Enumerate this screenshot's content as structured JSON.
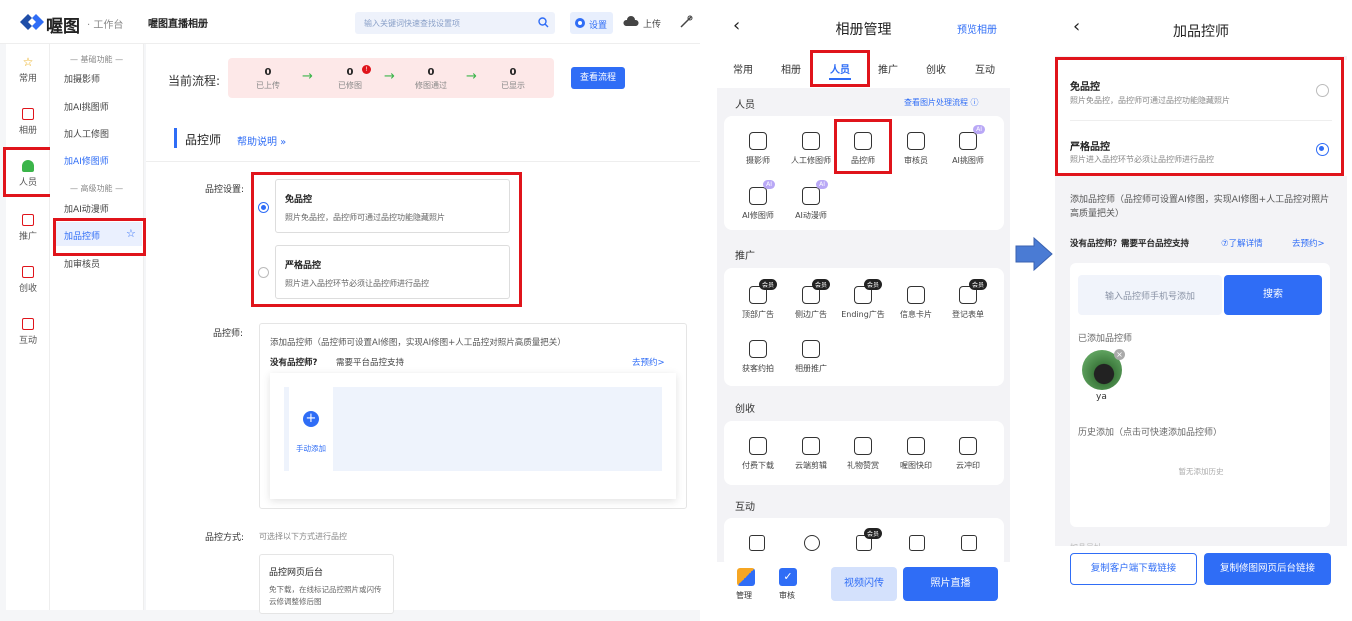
{
  "desktop": {
    "logo": "喔图",
    "workspace": "· 工作台",
    "album_title": "喔图直播相册",
    "search_placeholder": "输入关键词快速查找设置项",
    "settings": "设置",
    "upload": "上传",
    "leftnav": [
      "常用",
      "相册",
      "人员",
      "推广",
      "创收",
      "互动"
    ],
    "submenu": {
      "group1": "— 基础功能 —",
      "items1": [
        "加摄影师",
        "加AI挑图师",
        "加人工修图",
        "加AI修图师"
      ],
      "group2": "— 高级功能 —",
      "items2": [
        "加AI动漫师",
        "加品控师",
        "加审核员"
      ]
    },
    "flow_label": "当前流程:",
    "flow": [
      {
        "value": "0",
        "label": "已上传"
      },
      {
        "value": "0",
        "label": "已修图"
      },
      {
        "value": "0",
        "label": "修图通过"
      },
      {
        "value": "0",
        "label": "已显示"
      }
    ],
    "view_flow_btn": "查看流程",
    "section_title": "品控师",
    "help": "帮助说明 »",
    "qc_setting_label": "品控设置:",
    "opt1_title": "免品控",
    "opt1_desc": "照片免品控，品控师可通过品控功能隐藏照片",
    "opt2_title": "严格品控",
    "opt2_desc": "照片进入品控环节必须让品控师进行品控",
    "qc_person_label": "品控师:",
    "add_desc": "添加品控师（品控师可设置AI修图，实现AI修图+人工品控对照片高质量把关）",
    "no_qc": "没有品控师?",
    "need_support": "需要平台品控支持",
    "reserve": "去预约>",
    "manual_add": "手动添加",
    "qc_method_label": "品控方式:",
    "qc_method_hint": "可选择以下方式进行品控",
    "web_backend": "品控网页后台",
    "web_backend_desc1": "免下载，在线标记品控照片或闪传",
    "web_backend_desc2": "云修调整修后图"
  },
  "phone1": {
    "title": "相册管理",
    "preview": "预览相册",
    "tabs": [
      "常用",
      "相册",
      "人员",
      "推广",
      "创收",
      "互动"
    ],
    "staff_title": "人员",
    "staff_link": "查看图片处理流程 ⓘ",
    "staff": [
      "摄影师",
      "人工修图师",
      "品控师",
      "审核员",
      "AI挑图师",
      "AI修图师",
      "AI动漫师"
    ],
    "ai_badge": "AI",
    "promo_title": "推广",
    "promo": [
      "顶部广告",
      "侧边广告",
      "Ending广告",
      "信息卡片",
      "登记表单",
      "获客约拍",
      "相册推广"
    ],
    "member_badge": "会员",
    "income_title": "创收",
    "income": [
      "付费下载",
      "云端剪辑",
      "礼物赞赏",
      "喔图快印",
      "云冲印"
    ],
    "interact_title": "互动",
    "bottom_manage": "管理",
    "bottom_review": "审核",
    "video_flash": "视频闪传",
    "photo_live": "照片直播"
  },
  "phone2": {
    "title": "加品控师",
    "opt1_title": "免品控",
    "opt1_desc": "照片免品控，品控师可通过品控功能隐藏照片",
    "opt2_title": "严格品控",
    "opt2_desc": "照片进入品控环节必须让品控师进行品控",
    "add_desc": "添加品控师（品控师可设置AI修图，实现AI修图+人工品控对照片高质量把关）",
    "no_qc": "没有品控师？需要平台品控支持",
    "learn_more": "⑦了解详情",
    "reserve": "去预约>",
    "phone_placeholder": "输入品控师手机号添加",
    "search_btn": "搜索",
    "added_title": "已添加品控师",
    "added_user": "ya",
    "history_title": "历史添加（点击可快速添加品控师）",
    "no_history": "暂无添加历史",
    "partial": "加品号址",
    "copy_client": "复制客户端下载链接",
    "copy_web": "复制修图网页后台链接"
  },
  "colors": {
    "accent": "#2f6df6",
    "red": "#e0141b",
    "green": "#3bb54a"
  }
}
